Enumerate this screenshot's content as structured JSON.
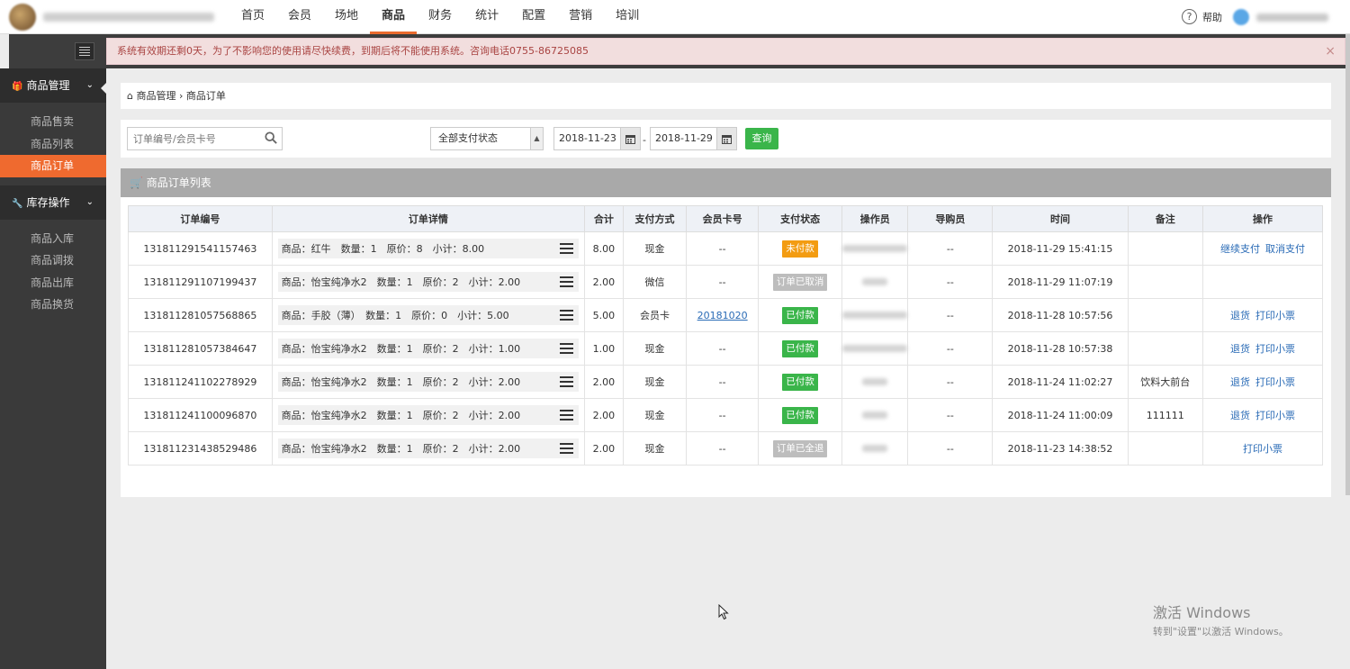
{
  "nav": {
    "items": [
      "首页",
      "会员",
      "场地",
      "商品",
      "财务",
      "统计",
      "配置",
      "营销",
      "培训"
    ],
    "active": "商品",
    "help_label": "帮助"
  },
  "alert": {
    "text": "系统有效期还剩0天，为了不影响您的使用请尽快续费，到期后将不能使用系统。咨询电话0755-86725085",
    "close": "×"
  },
  "sidebar": {
    "group1": {
      "label": "商品管理",
      "items": [
        "商品售卖",
        "商品列表",
        "商品订单"
      ],
      "active": "商品订单"
    },
    "group2": {
      "label": "库存操作",
      "items": [
        "商品入库",
        "商品调拨",
        "商品出库",
        "商品换货"
      ]
    }
  },
  "breadcrumb": {
    "root": "商品管理",
    "sep": " › ",
    "current": "商品订单"
  },
  "filters": {
    "search_placeholder": "订单编号/会员卡号",
    "pay_status": "全部支付状态",
    "date_from": "2018-11-23",
    "date_sep": "-",
    "date_to": "2018-11-29",
    "query_label": "查询"
  },
  "panel": {
    "title": "商品订单列表"
  },
  "table": {
    "headers": [
      "订单编号",
      "订单详情",
      "合计",
      "支付方式",
      "会员卡号",
      "支付状态",
      "操作员",
      "导购员",
      "时间",
      "备注",
      "操作"
    ],
    "rows": [
      {
        "id": "131811291541157463",
        "detail": "商品：红牛　数量：1　原价：8　小计：8.00",
        "total": "8.00",
        "pay": "现金",
        "card": "--",
        "status": "未付款",
        "status_color": "#f39c12",
        "guide": "--",
        "time": "2018-11-29 15:41:15",
        "note": "",
        "actions": [
          "继续支付",
          "取消支付"
        ]
      },
      {
        "id": "131811291107199437",
        "detail": "商品：怡宝纯净水2　数量：1　原价：2　小计：2.00",
        "total": "2.00",
        "pay": "微信",
        "card": "--",
        "status": "订单已取消",
        "status_color": "#bdbdbd",
        "guide": "--",
        "time": "2018-11-29 11:07:19",
        "note": "",
        "actions": []
      },
      {
        "id": "131811281057568865",
        "detail": "商品：手胶（薄）　数量：1　原价：0　小计：5.00",
        "total": "5.00",
        "pay": "会员卡",
        "card": "20181020",
        "status": "已付款",
        "status_color": "#3ab54a",
        "guide": "--",
        "time": "2018-11-28 10:57:56",
        "note": "",
        "actions": [
          "退货",
          "打印小票"
        ]
      },
      {
        "id": "131811281057384647",
        "detail": "商品：怡宝纯净水2　数量：1　原价：2　小计：1.00",
        "total": "1.00",
        "pay": "现金",
        "card": "--",
        "status": "已付款",
        "status_color": "#3ab54a",
        "guide": "--",
        "time": "2018-11-28 10:57:38",
        "note": "",
        "actions": [
          "退货",
          "打印小票"
        ]
      },
      {
        "id": "131811241102278929",
        "detail": "商品：怡宝纯净水2　数量：1　原价：2　小计：2.00",
        "total": "2.00",
        "pay": "现金",
        "card": "--",
        "status": "已付款",
        "status_color": "#3ab54a",
        "guide": "--",
        "time": "2018-11-24 11:02:27",
        "note": "饮料大前台",
        "actions": [
          "退货",
          "打印小票"
        ]
      },
      {
        "id": "131811241100096870",
        "detail": "商品：怡宝纯净水2　数量：1　原价：2　小计：2.00",
        "total": "2.00",
        "pay": "现金",
        "card": "--",
        "status": "已付款",
        "status_color": "#3ab54a",
        "guide": "--",
        "time": "2018-11-24 11:00:09",
        "note": "111111",
        "actions": [
          "退货",
          "打印小票"
        ]
      },
      {
        "id": "131811231438529486",
        "detail": "商品：怡宝纯净水2　数量：1　原价：2　小计：2.00",
        "total": "2.00",
        "pay": "现金",
        "card": "--",
        "status": "订单已全退",
        "status_color": "#bdbdbd",
        "guide": "--",
        "time": "2018-11-23 14:38:52",
        "note": "",
        "actions": [
          "打印小票"
        ]
      }
    ]
  },
  "watermark": {
    "line1": "激活 Windows",
    "line2": "转到\"设置\"以激活 Windows。"
  },
  "colors": {
    "accent": "#ef6a2f",
    "green": "#3ab54a",
    "orange": "#f39c12",
    "sidebar": "#3a3a3a"
  }
}
